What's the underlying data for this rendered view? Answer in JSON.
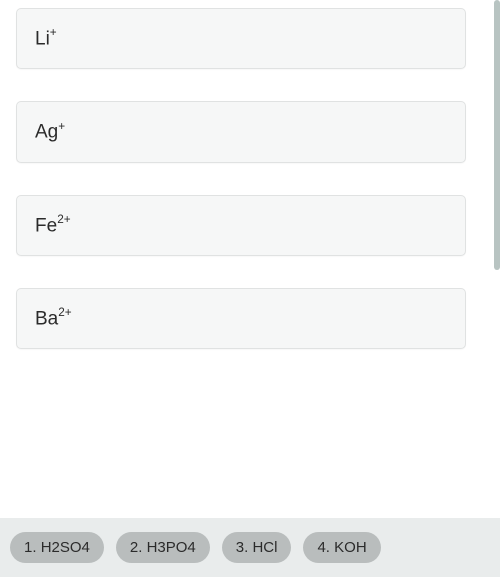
{
  "cards": [
    {
      "base": "Li",
      "charge": "+"
    },
    {
      "base": "Ag",
      "charge": "+"
    },
    {
      "base": "Fe",
      "charge": "2+"
    },
    {
      "base": "Ba",
      "charge": "2+"
    }
  ],
  "options": [
    {
      "num": "1.",
      "formula": "H2SO4"
    },
    {
      "num": "2.",
      "formula": "H3PO4"
    },
    {
      "num": "3.",
      "formula": "HCl"
    },
    {
      "num": "4.",
      "formula": "KOH"
    }
  ]
}
